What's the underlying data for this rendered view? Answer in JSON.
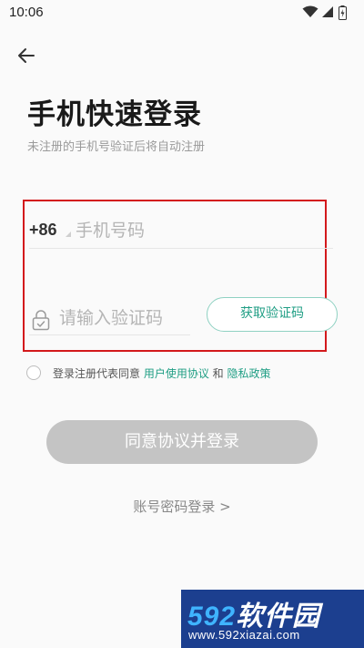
{
  "status_bar": {
    "time": "10:06",
    "icons": [
      "wifi-icon",
      "signal-icon",
      "battery-icon"
    ]
  },
  "header": {
    "back_icon": "arrow-left-icon"
  },
  "title": "手机快速登录",
  "subtitle": "未注册的手机号验证后将自动注册",
  "form": {
    "country_code": "+86",
    "phone_placeholder": "手机号码",
    "phone_value": "",
    "code_placeholder": "请输入验证码",
    "code_value": "",
    "get_code_label": "获取验证码"
  },
  "agreement": {
    "checked": false,
    "prefix": "登录注册代表同意 ",
    "user_agreement": "用户使用协议",
    "conjunction": " 和 ",
    "privacy_policy": "隐私政策"
  },
  "login_button_label": "同意协议并登录",
  "account_login_label": "账号密码登录 >",
  "watermark": {
    "logo_num": "592",
    "logo_text": "软件园",
    "url": "www.592xiazai.com"
  },
  "colors": {
    "accent": "#1f9e84",
    "accent_border": "#8fd1c2",
    "disabled_button": "#c4c4c4",
    "highlight_border": "#d3191c",
    "background": "#fafafa",
    "watermark_bg": "#1c3f8f"
  }
}
